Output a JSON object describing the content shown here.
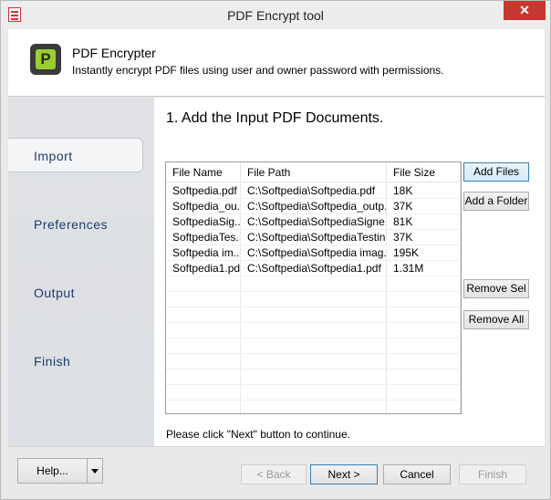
{
  "window": {
    "title": "PDF Encrypt tool",
    "close_glyph": "✕"
  },
  "header": {
    "logo_letter": "P",
    "title": "PDF Encrypter",
    "subtitle": "Instantly encrypt PDF files using user and owner password with permissions."
  },
  "sidebar": {
    "items": [
      {
        "label": "Import",
        "active": true
      },
      {
        "label": "Preferences",
        "active": false
      },
      {
        "label": "Output",
        "active": false
      },
      {
        "label": "Finish",
        "active": false
      }
    ]
  },
  "main": {
    "step_title": "1. Add the Input PDF Documents.",
    "columns": [
      "File Name",
      "File Path",
      "File Size"
    ],
    "rows": [
      {
        "name": "Softpedia.pdf",
        "path": "C:\\Softpedia\\Softpedia.pdf",
        "size": "18K"
      },
      {
        "name": "Softpedia_ou...",
        "path": "C:\\Softpedia\\Softpedia_outp...",
        "size": "37K"
      },
      {
        "name": "SoftpediaSig...",
        "path": "C:\\Softpedia\\SoftpediaSigne...",
        "size": "81K"
      },
      {
        "name": "SoftpediaTes...",
        "path": "C:\\Softpedia\\SoftpediaTestin...",
        "size": "37K"
      },
      {
        "name": "Softpedia im...",
        "path": "C:\\Softpedia\\Softpedia imag...",
        "size": "195K"
      },
      {
        "name": "Softpedia1.pdf",
        "path": "C:\\Softpedia\\Softpedia1.pdf",
        "size": "1.31M"
      }
    ],
    "buttons": {
      "add_files": "Add Files",
      "add_folder": "Add a Folder",
      "remove_sel": "Remove Sel",
      "remove_all": "Remove All"
    },
    "hint": "Please click \"Next\" button to continue."
  },
  "footer": {
    "help": "Help...",
    "back": "< Back",
    "next": "Next >",
    "cancel": "Cancel",
    "finish": "Finish"
  },
  "colors": {
    "nav_text": "#1f3b6e",
    "close_bg": "#c7372f",
    "logo_accent": "#9acd32"
  }
}
